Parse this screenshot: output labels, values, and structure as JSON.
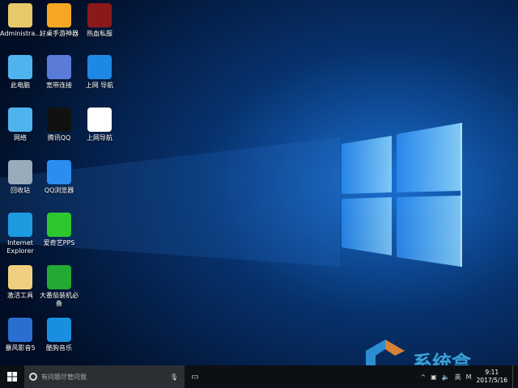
{
  "desktop_icons": [
    {
      "label": "Administra...",
      "icon": "user-folder-icon",
      "color": "#e8c96a"
    },
    {
      "label": "好桌手游神器",
      "icon": "game-monster-icon",
      "color": "#f5a623"
    },
    {
      "label": "热血私服",
      "icon": "hot-game-icon",
      "color": "#8a1a1a"
    },
    {
      "label": "此电脑",
      "icon": "computer-icon",
      "color": "#4fb4ee"
    },
    {
      "label": "宽带连接",
      "icon": "broadband-icon",
      "color": "#5a7bd8"
    },
    {
      "label": "上网 导航",
      "icon": "edge-icon",
      "color": "#1e88e5"
    },
    {
      "label": "网络",
      "icon": "network-icon",
      "color": "#4fb4ee"
    },
    {
      "label": "腾讯QQ",
      "icon": "qq-penguin-icon",
      "color": "#111111"
    },
    {
      "label": "上网导航",
      "icon": "edge-file-icon",
      "color": "#ffffff"
    },
    {
      "label": "回收站",
      "icon": "recycle-bin-icon",
      "color": "#9ab"
    },
    {
      "label": "QQ浏览器",
      "icon": "qq-browser-icon",
      "color": "#2a8ef0"
    },
    {
      "label": "Internet Explorer",
      "icon": "ie-icon",
      "color": "#1e9ae0"
    },
    {
      "label": "爱奇艺PPS",
      "icon": "iqiyi-icon",
      "color": "#2ec82e"
    },
    {
      "label": "激活工具",
      "icon": "activation-file-icon",
      "color": "#f0d080"
    },
    {
      "label": "大番茄装机必备",
      "icon": "shopping-bag-icon",
      "color": "#22aa33"
    },
    {
      "label": "暴风影音5",
      "icon": "storm-player-icon",
      "color": "#2a6fd0"
    },
    {
      "label": "酷狗音乐",
      "icon": "kugou-icon",
      "color": "#1a8fe0"
    }
  ],
  "taskbar": {
    "search_placeholder": "有问题尽管问我",
    "tray_ime": "英",
    "time": "9:11",
    "date": "2017/5/16"
  },
  "watermark": {
    "text": "系统盒"
  }
}
